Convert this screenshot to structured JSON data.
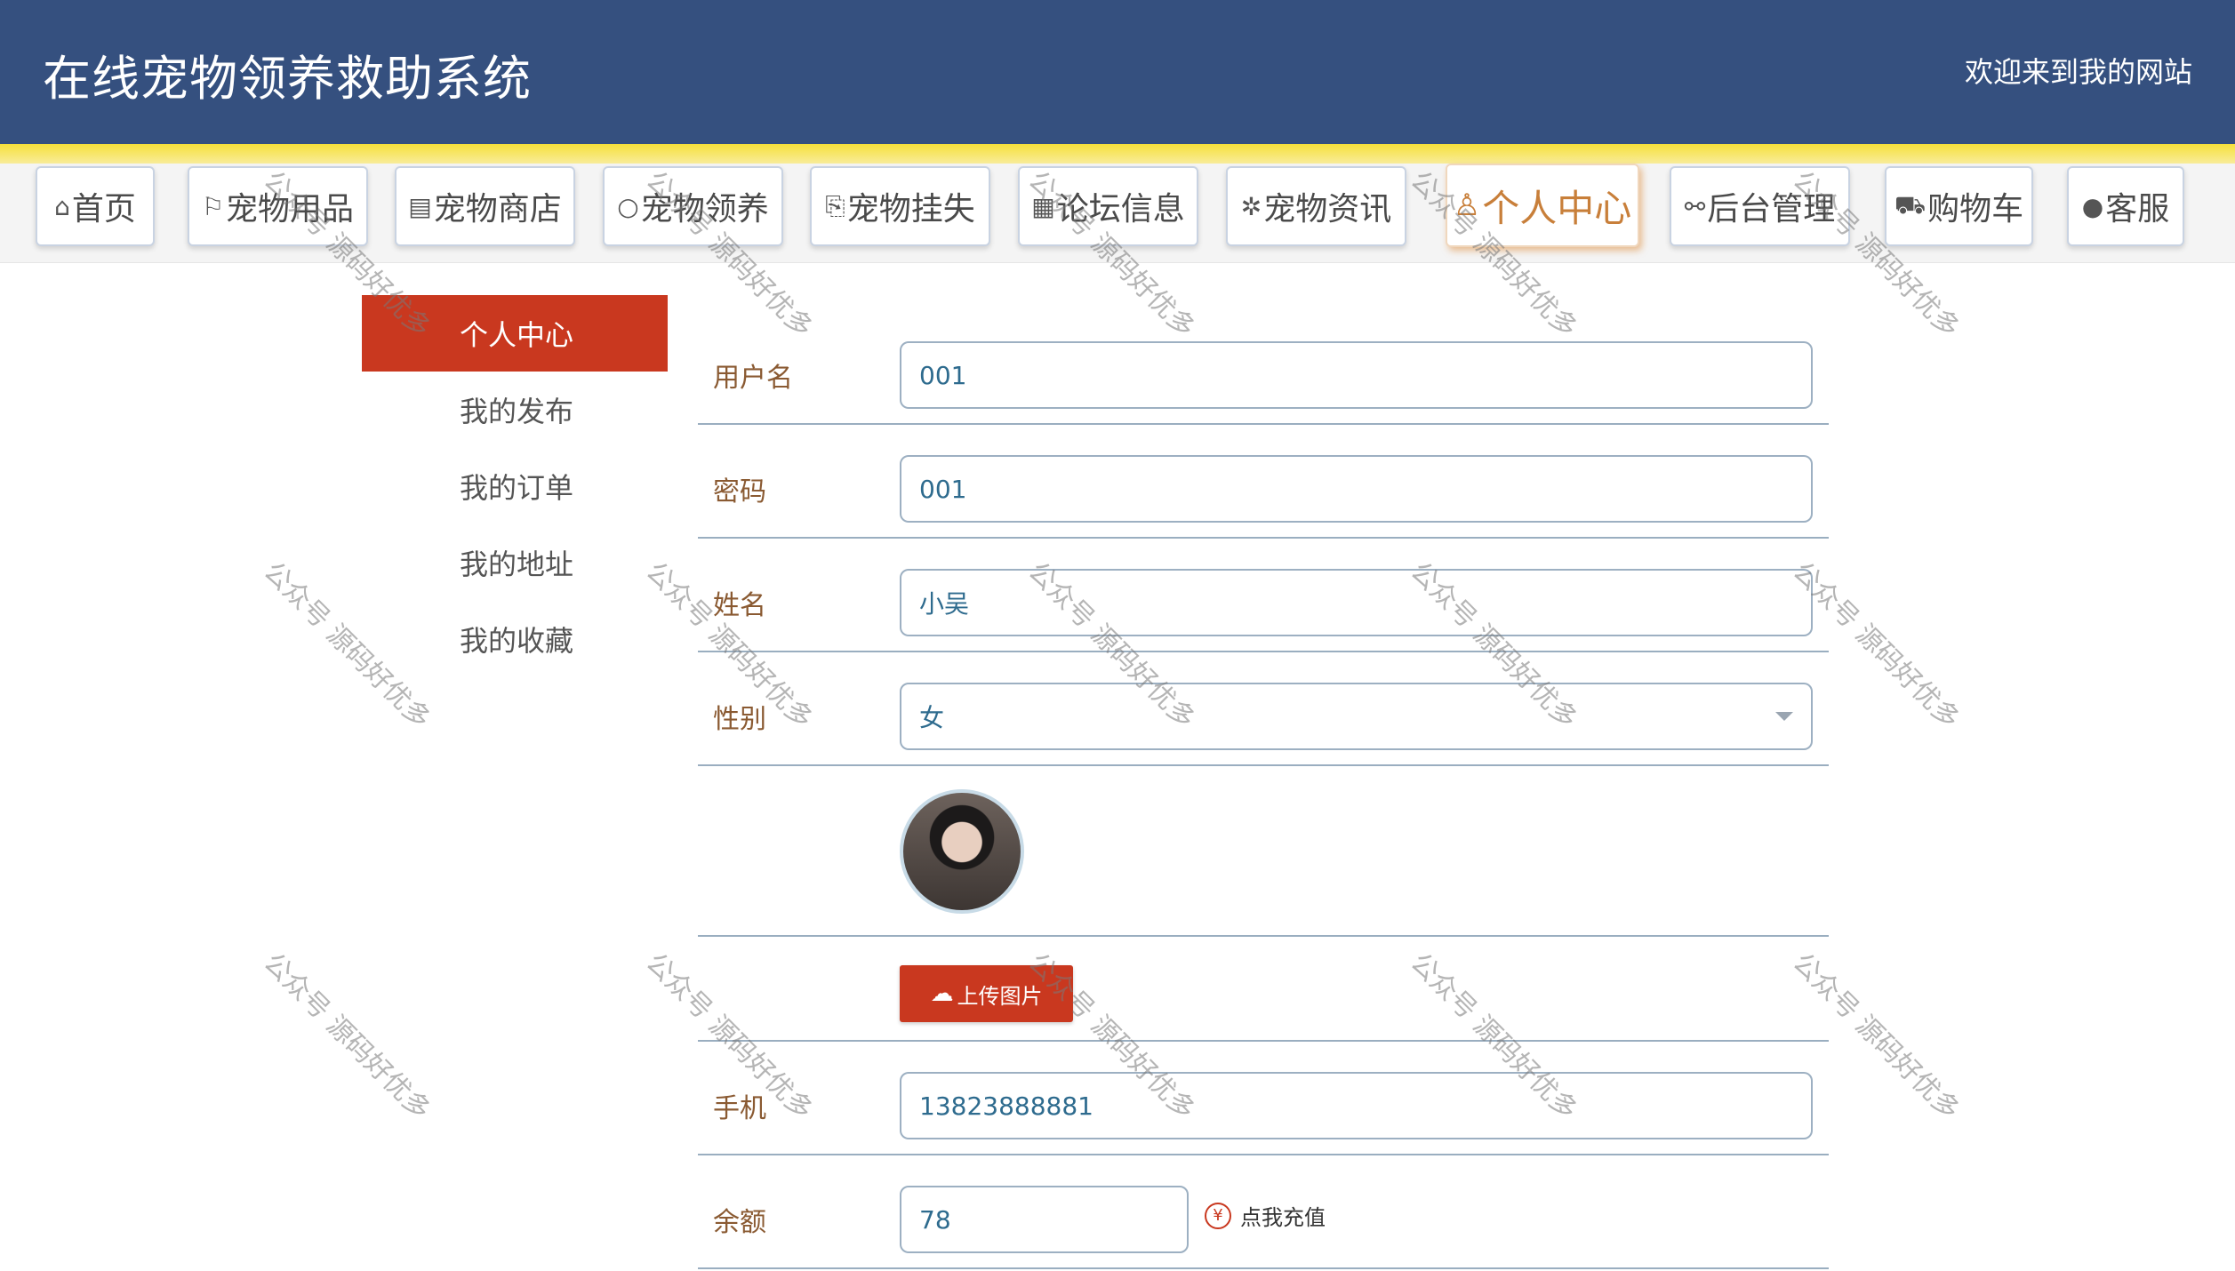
{
  "header": {
    "title": "在线宠物领养救助系统",
    "welcome": "欢迎来到我的网站"
  },
  "nav": {
    "items": [
      {
        "icon": "home-icon",
        "glyph": "⌂",
        "label": "首页"
      },
      {
        "icon": "flag-icon",
        "glyph": "⚐",
        "label": "宠物用品"
      },
      {
        "icon": "store-icon",
        "glyph": "▤",
        "label": "宠物商店"
      },
      {
        "icon": "circle-icon",
        "glyph": "○",
        "label": "宠物领养"
      },
      {
        "icon": "book-icon",
        "glyph": "⎘",
        "label": "宠物挂失"
      },
      {
        "icon": "grid-icon",
        "glyph": "▦",
        "label": "论坛信息"
      },
      {
        "icon": "news-icon",
        "glyph": "✲",
        "label": "宠物资讯"
      },
      {
        "icon": "user-icon",
        "glyph": "♙",
        "label": "个人中心"
      },
      {
        "icon": "link-icon",
        "glyph": "⚯",
        "label": "后台管理"
      },
      {
        "icon": "cart-icon",
        "glyph": "⛟",
        "label": "购物车"
      },
      {
        "icon": "chat-icon",
        "glyph": "●",
        "label": "客服"
      }
    ],
    "active_index": 7,
    "accent_color": "#c87f3a"
  },
  "sidebar": {
    "items": [
      {
        "label": "个人中心"
      },
      {
        "label": "我的发布"
      },
      {
        "label": "我的订单"
      },
      {
        "label": "我的地址"
      },
      {
        "label": "我的收藏"
      }
    ],
    "active_color": "#c9381f"
  },
  "form": {
    "username": {
      "label": "用户名",
      "value": "001"
    },
    "password": {
      "label": "密码",
      "value": "001"
    },
    "name": {
      "label": "姓名",
      "value": "小吴"
    },
    "gender": {
      "label": "性别",
      "value": "女"
    },
    "upload_label": "上传图片",
    "phone": {
      "label": "手机",
      "value": "13823888881"
    },
    "balance": {
      "label": "余额",
      "value": "78"
    },
    "recharge_label": "点我充值",
    "recharge_icon": "¥"
  },
  "watermark": "公众号 源码好优多",
  "colors": {
    "header_bg": "#35507f",
    "accent_strip": "#f6e03a",
    "primary_red": "#c9381f"
  }
}
